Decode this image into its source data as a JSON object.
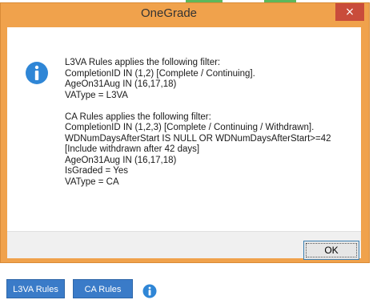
{
  "dialog": {
    "title": "OneGrade",
    "close_glyph": "×",
    "ok_label": "OK",
    "icon": "info-icon",
    "message_lines": [
      "L3VA Rules applies the following filter:",
      "CompletionID IN (1,2) [Complete / Continuing].",
      "AgeOn31Aug IN (16,17,18)",
      "VAType = L3VA",
      "",
      "CA Rules applies the following filter:",
      "CompletionID IN (1,2,3) [Complete / Continuing / Withdrawn].",
      "WDNumDaysAfterStart IS NULL OR WDNumDaysAfterStart>=42",
      "[Include withdrawn after 42 days]",
      "AgeOn31Aug IN (16,17,18)",
      "IsGraded = Yes",
      "VAType = CA"
    ]
  },
  "toolbar": {
    "l3va_label": "L3VA Rules",
    "ca_label": "CA Rules",
    "info_icon": "info-icon"
  },
  "colors": {
    "dialog_frame": "#f0a24c",
    "close_button": "#c94c3b",
    "toolbar_button": "#3a7bc8",
    "info_blue": "#2f86d6"
  }
}
